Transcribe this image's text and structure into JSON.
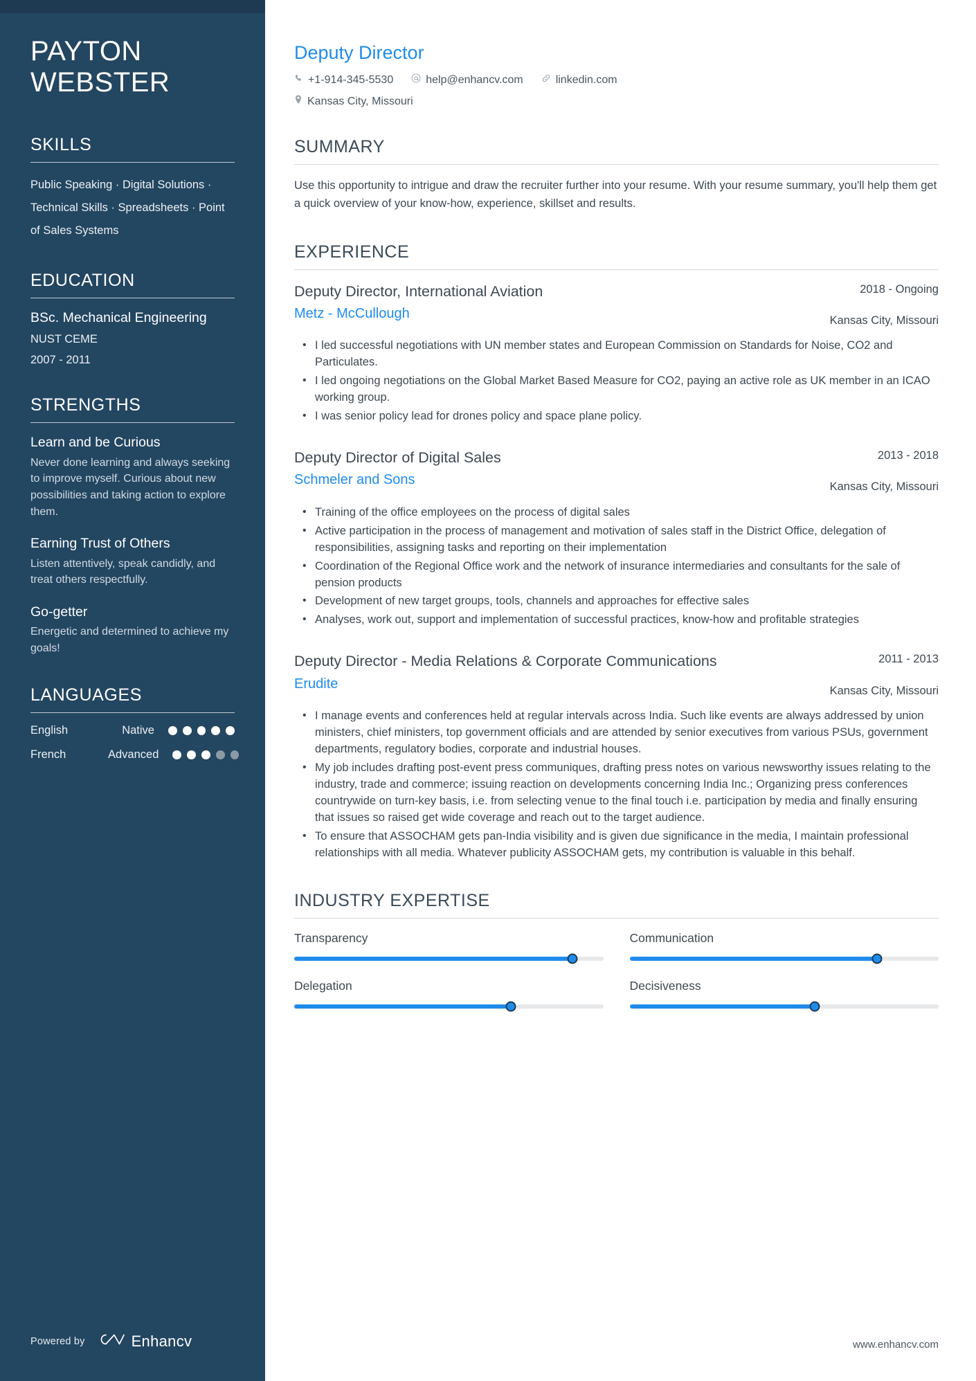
{
  "sidebar": {
    "name_lines": [
      "PAYTON",
      "WEBSTER"
    ],
    "skills": {
      "heading": "SKILLS",
      "text": "Public Speaking · Digital Solutions · Technical Skills · Spreadsheets · Point of Sales Systems"
    },
    "education": {
      "heading": "EDUCATION",
      "degree": "BSc. Mechanical Engineering",
      "school": "NUST CEME",
      "dates": "2007 - 2011"
    },
    "strengths": {
      "heading": "STRENGTHS",
      "items": [
        {
          "title": "Learn and be Curious",
          "desc": "Never done learning and always seeking to improve myself. Curious about new possibilities and taking action to explore them."
        },
        {
          "title": "Earning Trust of Others",
          "desc": "Listen attentively, speak candidly, and treat others respectfully."
        },
        {
          "title": "Go-getter",
          "desc": "Energetic and determined to achieve my goals!"
        }
      ]
    },
    "languages": {
      "heading": "LANGUAGES",
      "items": [
        {
          "name": "English",
          "level": "Native",
          "filled": 5,
          "total": 5
        },
        {
          "name": "French",
          "level": "Advanced",
          "filled": 3,
          "total": 5
        }
      ]
    },
    "footer": {
      "powered_by": "Powered by",
      "brand": "Enhancv"
    }
  },
  "main": {
    "job_title": "Deputy Director",
    "contacts": [
      {
        "icon": "phone-icon",
        "text": "+1-914-345-5530"
      },
      {
        "icon": "email-icon",
        "text": "help@enhancv.com"
      },
      {
        "icon": "link-icon",
        "text": "linkedin.com"
      },
      {
        "icon": "location-icon",
        "text": "Kansas City, Missouri"
      }
    ],
    "summary": {
      "heading": "SUMMARY",
      "text": "Use this opportunity to intrigue and draw the recruiter further into your resume. With your resume summary, you'll help them get a quick overview of your know-how, experience, skillset and results."
    },
    "experience": {
      "heading": "EXPERIENCE",
      "jobs": [
        {
          "role": "Deputy Director, International Aviation",
          "company": "Metz - McCullough",
          "dates": "2018 - Ongoing",
          "location": "Kansas City, Missouri",
          "bullets": [
            "I led successful negotiations with UN member states and European Commission on Standards for Noise, CO2 and Particulates.",
            "I led ongoing negotiations on the Global Market Based Measure for CO2, paying an active role as UK member in an ICAO working group.",
            "I was senior policy lead for drones policy and space plane policy."
          ]
        },
        {
          "role": "Deputy Director of Digital Sales",
          "company": "Schmeler and Sons",
          "dates": "2013 - 2018",
          "location": "Kansas City, Missouri",
          "bullets": [
            "Training of the office employees on the process of digital sales",
            "Active participation in the process of management and motivation of sales staff in the District Office, delegation of responsibilities, assigning tasks and reporting on their implementation",
            "Coordination of the Regional Office work and the network of insurance intermediaries and consultants for the sale of pension products",
            "Development of new target groups, tools, channels and approaches for effective sales",
            "Analyses, work out, support and implementation of successful practices, know-how and profitable strategies"
          ]
        },
        {
          "role": "Deputy Director - Media Relations & Corporate Communications",
          "company": "Erudite",
          "dates": "2011 - 2013",
          "location": "Kansas City, Missouri",
          "bullets": [
            "I manage events and conferences held at regular intervals across India. Such like events are always addressed by union ministers, chief ministers, top government officials and are attended by senior executives from various PSUs, government departments, regulatory bodies, corporate and industrial houses.",
            "My job includes drafting post-event press communiques, drafting press notes on various newsworthy issues relating to the industry, trade and commerce; issuing reaction on developments concerning India Inc.; Organizing press conferences countrywide on turn-key basis, i.e. from selecting venue to the final touch i.e. participation by media and finally ensuring that issues so raised get wide coverage and reach out to the target audience.",
            "To ensure that ASSOCHAM gets pan-India visibility and is given due significance in the media, I maintain professional relationships with all media. Whatever publicity ASSOCHAM gets, my contribution is valuable in this behalf."
          ]
        }
      ]
    },
    "industry_expertise": {
      "heading": "INDUSTRY EXPERTISE",
      "items": [
        {
          "label": "Transparency",
          "value": 90
        },
        {
          "label": "Communication",
          "value": 80
        },
        {
          "label": "Delegation",
          "value": 70
        },
        {
          "label": "Decisiveness",
          "value": 60
        }
      ]
    },
    "footer_url": "www.enhancv.com"
  },
  "colors": {
    "sidebar_bg": "#234661",
    "accent": "#1f8ceb",
    "heading": "#3b4a57",
    "body_text": "#3d4852"
  }
}
